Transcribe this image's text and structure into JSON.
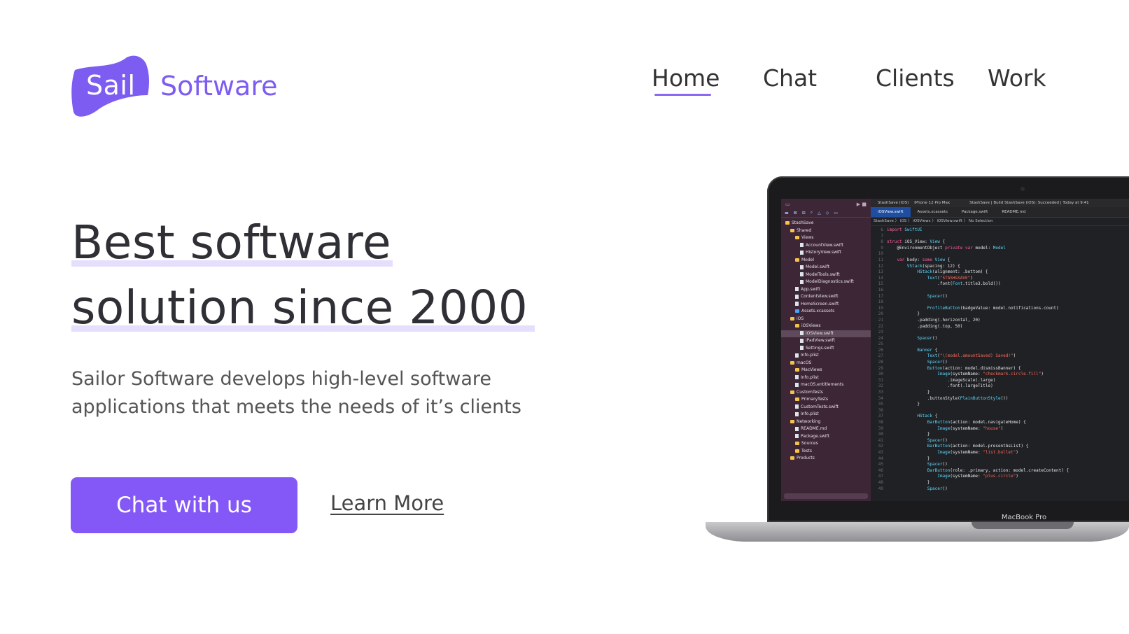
{
  "brand": {
    "badge": "Sail",
    "word": "Software",
    "color": "#7d5cf2"
  },
  "nav": {
    "items": [
      "Home",
      "Chat",
      "Clients",
      "Work"
    ],
    "active": "Home"
  },
  "hero": {
    "headline_line1": "Best software",
    "headline_line2": "solution since 2000",
    "subtitle": "Sailor Software develops high-level software applications that meets the needs of it’s clients",
    "cta_label": "Chat with us",
    "learn_more": "Learn More",
    "accent_color": "#8458f6"
  },
  "laptop": {
    "model": "MacBook Pro",
    "toolbar": [
      "StashSave (iOS)",
      "iPhone 12 Pro Max",
      "StashSave | Build StashSave (iOS): Succeeded | Today at 9:41"
    ],
    "tabs": [
      "iOSView.swift",
      "Assets.xcassets",
      "Package.swift",
      "README.md"
    ],
    "breadcrumb": "StashSave 〉 iOS 〉 iOSViews 〉 iOSView.swift 〉 No Selection",
    "file_tree": [
      "StashSave",
      "Shared",
      "Views",
      "AccountView.swift",
      "HistoryView.swift",
      "Model",
      "Model.swift",
      "ModelTools.swift",
      "ModelDiagnostics.swift",
      "App.swift",
      "ContentView.swift",
      "HomeScreen.swift",
      "Assets.xcassets",
      "iOS",
      "iOSViews",
      "iOSView.swift",
      "iPadView.swift",
      "Settings.swift",
      "Info.plist",
      "macOS",
      "MacViews",
      "Info.plist",
      "macOS.entitlements",
      "CustomTests",
      "PrimaryTests",
      "CustomTests.swift",
      "Info.plist",
      "Networking",
      "README.md",
      "Package.swift",
      "Sources",
      "Tests",
      "Products"
    ],
    "code_lines": [
      "import SwiftUI",
      "",
      "struct iOS_View: View {",
      "    @EnvironmentObject private var model: Model",
      "",
      "    var body: some View {",
      "        VStack(spacing: 12) {",
      "            HStack(alignment: .bottom) {",
      "                Text(\"STASH&SAVE\")",
      "                    .font(Font.title3.bold())",
      "",
      "                Spacer()",
      "",
      "                ProfileButton(badgeValue: model.notifications.count)",
      "            }",
      "            .padding(.horizontal, 20)",
      "            .padding(.top, 50)",
      "",
      "            Spacer()",
      "",
      "            Banner {",
      "                Text(\"\\(model.amountSaved) Saved!\")",
      "                Spacer()",
      "                Button(action: model.dismissBanner) {",
      "                    Image(systemName: \"checkmark.circle.fill\")",
      "                        .imageScale(.large)",
      "                        .font(.largeTitle)",
      "                }",
      "                .buttonStyle(PlainButtonStyle())",
      "            }",
      "",
      "            HStack {",
      "                BarButton(action: model.navigateHome) {",
      "                    Image(systemName: \"house\")",
      "                }",
      "                Spacer()",
      "                BarButton(action: model.presentAsList) {",
      "                    Image(systemName: \"list.bullet\")",
      "                }",
      "                Spacer()",
      "                BarButton(role: .primary, action: model.createContent) {",
      "                    Image(systemName: \"plus.circle\")",
      "                }",
      "                Spacer()"
    ]
  }
}
